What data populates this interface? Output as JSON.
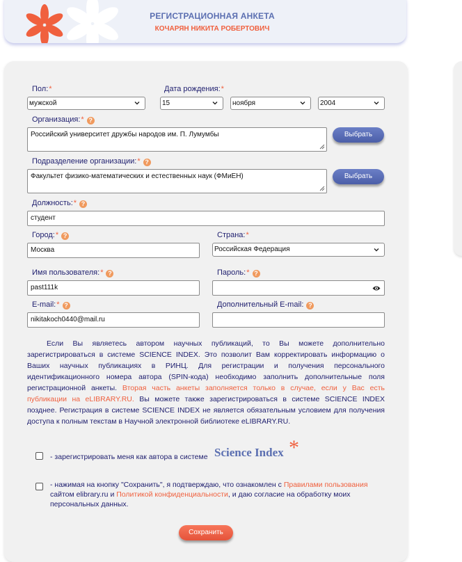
{
  "header": {
    "title": "РЕГИСТРАЦИОННАЯ АНКЕТА",
    "subtitle": "КОЧАРЯН НИКИТА РОБЕРТОВИЧ"
  },
  "colors": {
    "accent": "#f0603e",
    "brand": "#5b6fb1",
    "label": "#1e1e6e"
  },
  "form": {
    "gender": {
      "label": "Пол:",
      "value": "мужской"
    },
    "birth": {
      "label": "Дата рождения:",
      "day": "15",
      "month": "ноября",
      "year": "2004"
    },
    "org": {
      "label": "Организация:",
      "value": "Российский университет дружбы народов им. П. Лумумбы",
      "button": "Выбрать"
    },
    "dept": {
      "label": "Подразделение организации:",
      "value": "Факультет физико-математических и естественных наук (ФМиЕН)",
      "button": "Выбрать"
    },
    "position": {
      "label": "Должность:",
      "value": "студент"
    },
    "city": {
      "label": "Город:",
      "value": "Москва"
    },
    "country": {
      "label": "Страна:",
      "value": "Российская Федерация"
    },
    "username": {
      "label": "Имя пользователя:",
      "value": "past111k"
    },
    "password": {
      "label": "Пароль:",
      "value": ""
    },
    "email": {
      "label": "E-mail:",
      "value": "nikitakoch0440@mail.ru"
    },
    "email2": {
      "label": "Дополнительный E-mail:",
      "value": ""
    },
    "required_mark": "*",
    "help_mark": "?"
  },
  "info": {
    "part1": "Если Вы являетесь автором научных публикаций, то Вы можете дополнительно зарегистрироваться в системе SCIENCE INDEX. Это позволит Вам корректировать информацию о Ваших научных публикациях в РИНЦ. Для регистрации и получения персонального идентификационного номера автора (SPIN-кода) необходимо заполнить дополнительные поля регистрационной анкеты. ",
    "part2": "Вторая часть анкеты заполняется только в случае, если у Вас есть публикации на eLIBRARY.RU.",
    "part3": " Вы можете также зарегистрироваться в системе SCIENCE INDEX позднее. Регистрация в системе SCIENCE INDEX не является обязательным условием для получения доступа к полным текстам в Научной электронной библиотеке eLIBRARY.RU."
  },
  "checkboxes": {
    "author": {
      "label": "- зарегистрировать меня как автора в системе",
      "logo": "Science Index",
      "logo_star": "*"
    },
    "consent": {
      "t1": "- нажимая на кнопку \"Сохранить\", я подтверждаю, что ознакомлен с ",
      "link1": "Правилами пользования",
      "t2": " сайтом elibrary.ru и ",
      "link2": "Политикой конфиденциальности",
      "t3": ", и даю согласие на обработку моих персональных данных."
    }
  },
  "actions": {
    "save": "Сохранить"
  }
}
